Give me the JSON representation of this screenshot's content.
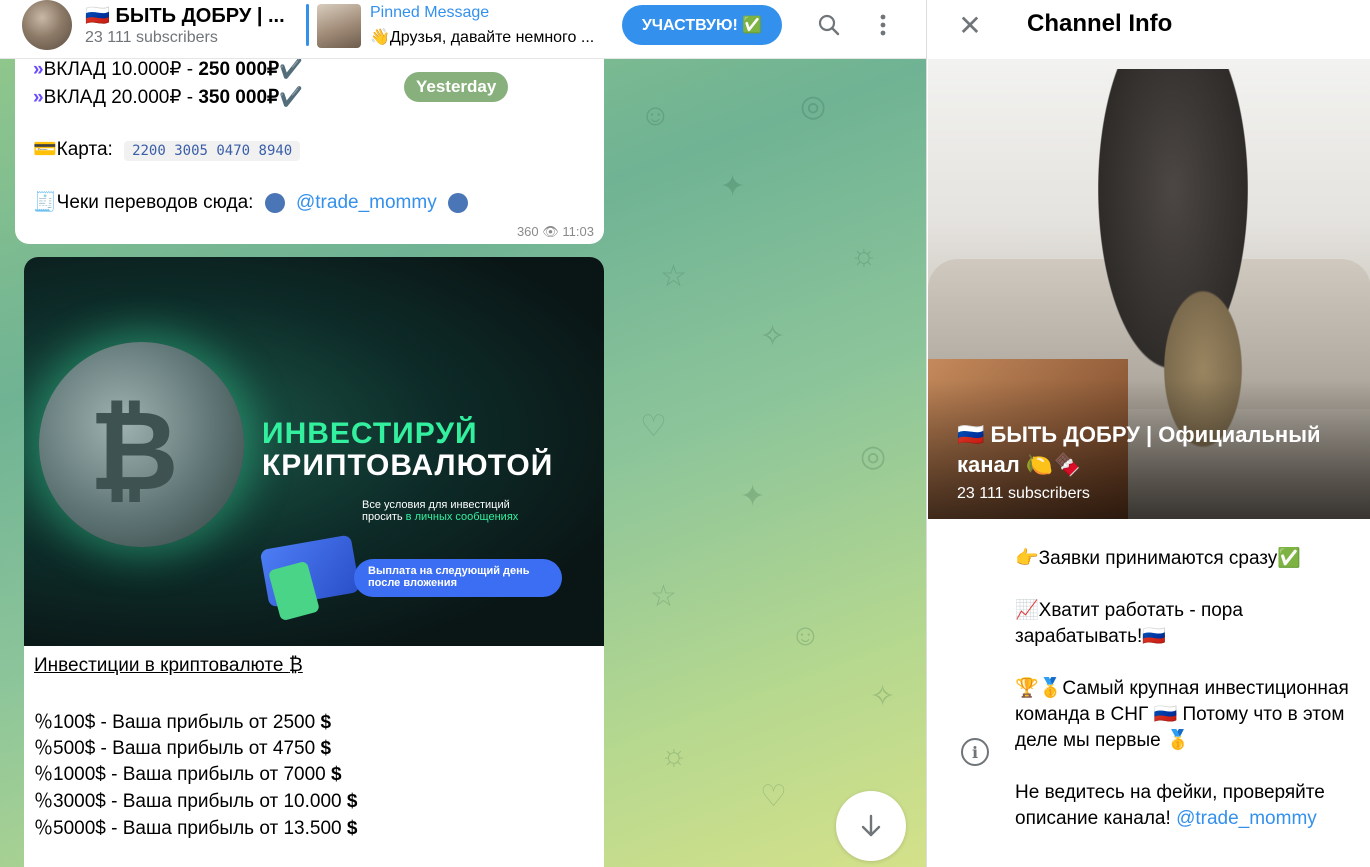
{
  "header": {
    "channel_title": "🇷🇺 БЫТЬ ДОБРУ | ...",
    "subscribers": "23 111 subscribers",
    "pinned_label": "Pinned Message",
    "pinned_text": "👋Друзья, давайте немного ...",
    "join_label": "УЧАСТВУЮ! ✅",
    "icons": [
      "search-icon",
      "more-vertical-icon"
    ]
  },
  "chat": {
    "date_badge": "Yesterday",
    "msg1": {
      "line1": "ВКЛАД 10.000₽ - ",
      "line1_bold": "250 000₽",
      "line2": "ВКЛАД 20.000₽ - ",
      "line2_bold": "350 000₽",
      "card_label": "Карта:",
      "card_number": "2200 3005 0470 8940",
      "receipts_label": "Чеки переводов сюда:",
      "mention": "@trade_mommy",
      "views": "360",
      "time": "11:03"
    },
    "msg2": {
      "banner_title1": "ИНВЕСТИРУЙ",
      "banner_title2": "КРИПТОВАЛЮТОЙ",
      "banner_sub1": "Все условия для инвестиций",
      "banner_sub2a": "просить ",
      "banner_sub2b": "в личных сообщениях",
      "banner_pill": "Выплата на следующий день после вложения",
      "title": "Инвестиции в криптовалюте",
      "lines": [
        "100$ - Ваша прибыль от 2500",
        "500$ - Ваша прибыль от 4750",
        "1000$ - Ваша прибыль от 7000",
        "3000$ - Ваша прибыль от 10.000",
        "5000$ - Ваша прибыль от 13.500"
      ]
    }
  },
  "panel": {
    "title": "Channel Info",
    "channel_name": "🇷🇺 БЫТЬ ДОБРУ | Официальный канал 🍋🍫",
    "subscribers": "23 111 subscribers",
    "description": [
      "👉Заявки принимаются сразу✅",
      "📈Хватит работать - пора зарабатывать!🇷🇺",
      "🏆🥇Самый крупная инвестиционная команда в СНГ 🇷🇺 Потому что в этом деле мы первые 🥇",
      "Не ведитесь на фейки, проверяйте описание канала! "
    ],
    "description_mention": "@trade_mommy"
  },
  "colors": {
    "accent": "#3390ec",
    "banner_green": "#33f09e",
    "pill_blue": "#3b6ef2"
  }
}
